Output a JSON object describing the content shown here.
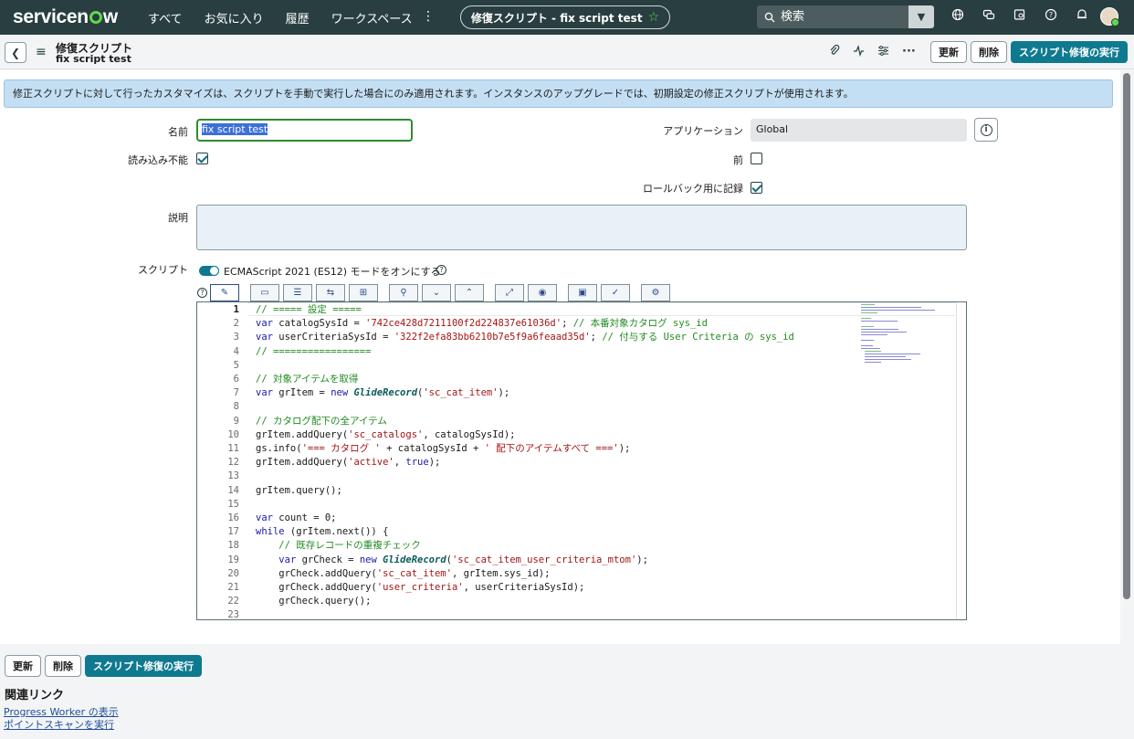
{
  "nav": {
    "logo": "servicenow",
    "links": [
      "すべて",
      "お気に入り",
      "履歴",
      "ワークスペース"
    ],
    "more": "⋮",
    "record_title": "修復スクリプト - fix script test",
    "search_placeholder": "検索"
  },
  "header": {
    "type_label": "修復スクリプト",
    "record_name": "fix script test",
    "update_button": "更新",
    "delete_button": "削除",
    "run_button": "スクリプト修復の実行"
  },
  "info_message": "修正スクリプトに対して行ったカスタマイズは、スクリプトを手動で実行した場合にのみ適用されます。インスタンスのアップグレードでは、初期設定の修正スクリプトが使用されます。",
  "form": {
    "name_label": "名前",
    "name_value": "fix script test",
    "application_label": "アプリケーション",
    "application_value": "Global",
    "unloadable_label": "読み込み不能",
    "unloadable_checked": true,
    "before_label": "前",
    "before_checked": false,
    "rollback_label": "ロールバック用に記録",
    "rollback_checked": true,
    "description_label": "説明",
    "script_label": "スクリプト",
    "es12_label": "ECMAScript 2021 (ES12) モードをオンにする"
  },
  "script_lines": [
    {
      "n": "1",
      "t": "// ===== 設定 ====="
    },
    {
      "n": "2",
      "t": "var catalogSysId = '742ce428d7211100f2d224837e61036d'; // 本番対象カタログ sys_id"
    },
    {
      "n": "3",
      "t": "var userCriteriaSysId = '322f2efa83bb6210b7e5f9a6feaad35d'; // 付与する User Criteria の sys_id"
    },
    {
      "n": "4",
      "t": "// ================="
    },
    {
      "n": "5",
      "t": ""
    },
    {
      "n": "6",
      "t": "// 対象アイテムを取得"
    },
    {
      "n": "7",
      "t": "var grItem = new GlideRecord('sc_cat_item');"
    },
    {
      "n": "8",
      "t": ""
    },
    {
      "n": "9",
      "t": "// カタログ配下の全アイテム"
    },
    {
      "n": "10",
      "t": "grItem.addQuery('sc_catalogs', catalogSysId);"
    },
    {
      "n": "11",
      "t": "gs.info('=== カタログ ' + catalogSysId + ' 配下のアイテムすべて ===');"
    },
    {
      "n": "12",
      "t": "grItem.addQuery('active', true);"
    },
    {
      "n": "13",
      "t": ""
    },
    {
      "n": "14",
      "t": "grItem.query();"
    },
    {
      "n": "15",
      "t": ""
    },
    {
      "n": "16",
      "t": "var count = 0;"
    },
    {
      "n": "17",
      "t": "while (grItem.next()) {"
    },
    {
      "n": "18",
      "t": "    // 既存レコードの重複チェック"
    },
    {
      "n": "19",
      "t": "    var grCheck = new GlideRecord('sc_cat_item_user_criteria_mtom');"
    },
    {
      "n": "20",
      "t": "    grCheck.addQuery('sc_cat_item', grItem.sys_id);"
    },
    {
      "n": "21",
      "t": "    grCheck.addQuery('user_criteria', userCriteriaSysId);"
    },
    {
      "n": "22",
      "t": "    grCheck.query();"
    },
    {
      "n": "23",
      "t": ""
    }
  ],
  "footer": {
    "update_button": "更新",
    "delete_button": "削除",
    "run_button": "スクリプト修復の実行",
    "related_title": "関連リンク",
    "links": [
      "Progress Worker の表示",
      "ポイントスキャンを実行"
    ]
  },
  "colors": {
    "nav_bg": "#293e40",
    "primary": "#0f7a8f",
    "accent_green": "#62d84e"
  }
}
